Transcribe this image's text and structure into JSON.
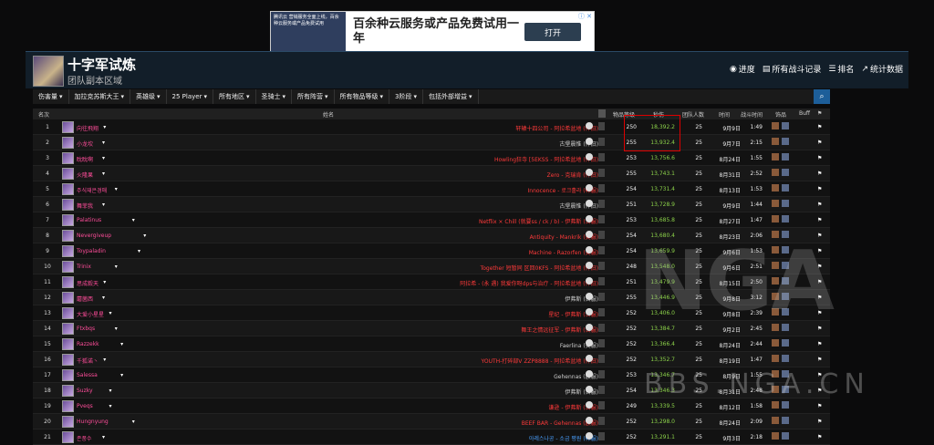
{
  "ad": {
    "left_text": "腾讯云 营销服务全面上线，百余种云服务或产品免费试用",
    "headline": "百余种云服务或产品免费试用一年",
    "button": "打开",
    "close": "ⓘ ✕"
  },
  "header": {
    "title": "十字军试炼",
    "subtitle": "团队副本区域",
    "nav": [
      {
        "icon": "globe-icon",
        "label": "进度"
      },
      {
        "icon": "list-icon",
        "label": "所有战斗记录"
      },
      {
        "icon": "ranking-icon",
        "label": "排名"
      },
      {
        "icon": "chart-icon",
        "label": "统计数据"
      }
    ]
  },
  "filters": [
    "伤害量",
    "加拉克苏斯大王",
    "英雄级",
    "25 Player",
    "所有地区",
    "圣骑士",
    "所有阵营",
    "所有物品等级",
    "3阶段",
    "包括外部增益"
  ],
  "columns": {
    "rank": "名次",
    "name": "姓名",
    "ilvl": "物品等级",
    "dps": "秒伤",
    "group": "团队人数",
    "date": "时间",
    "duration": "战斗时间",
    "gear": "饰品",
    "buff": "Buff"
  },
  "rows": [
    {
      "rank": "1",
      "name": "向往飛翔",
      "guild": "轩辕十四公司 - 阿拉希盆地 (怀旧)",
      "guild_color": "#ff3a3a",
      "ilvl": "250",
      "dps": "18,392.2",
      "group": "25",
      "date": "9月9日",
      "time": "1:49"
    },
    {
      "rank": "2",
      "name": "小龙坎",
      "guild": "古堡晨惟 (怀旧)",
      "guild_color": "#cfcfcf",
      "ilvl": "255",
      "dps": "13,932.4",
      "group": "25",
      "date": "9月7日",
      "time": "2:15"
    },
    {
      "rank": "3",
      "name": "眈眈啊",
      "guild": "Howling狂寺 [5EKSS - 阿拉希盆地 (怀旧)",
      "guild_color": "#ff3a3a",
      "ilvl": "253",
      "dps": "13,756.6",
      "group": "25",
      "date": "8月24日",
      "time": "1:55"
    },
    {
      "rank": "4",
      "name": "火隆果",
      "guild": "Zero - 克瑞肯 (怀旧)",
      "guild_color": "#ff3a3a",
      "ilvl": "255",
      "dps": "13,743.1",
      "group": "25",
      "date": "8月31日",
      "time": "2:52"
    },
    {
      "rank": "5",
      "name": "주식재은경매",
      "guild": "Innocence - 로크홀라 (韩服)",
      "guild_color": "#ff3a3a",
      "ilvl": "254",
      "dps": "13,731.4",
      "group": "25",
      "date": "8月13日",
      "time": "1:53"
    },
    {
      "rank": "6",
      "name": "舞菲我",
      "guild": "古堡晨惟 (怀旧)",
      "guild_color": "#cfcfcf",
      "ilvl": "251",
      "dps": "13,728.9",
      "group": "25",
      "date": "9月9日",
      "time": "1:44"
    },
    {
      "rank": "7",
      "name": "Palatinus",
      "guild": "Netflix × Chill (就要ss / ck / b) - 伊弗斯 (台服)",
      "guild_color": "#ff3a3a",
      "ilvl": "253",
      "dps": "13,685.8",
      "group": "25",
      "date": "8月27日",
      "time": "1:47"
    },
    {
      "rank": "8",
      "name": "Nevergiveup",
      "guild": "Antiquity - Mankrik (美服)",
      "guild_color": "#ff3a3a",
      "ilvl": "254",
      "dps": "13,680.4",
      "group": "25",
      "date": "8月23日",
      "time": "2:06"
    },
    {
      "rank": "9",
      "name": "Toypaladin",
      "guild": "Machine - Razorfen (美服)",
      "guild_color": "#ff3a3a",
      "ilvl": "254",
      "dps": "13,659.9",
      "group": "25",
      "date": "9月6日",
      "time": "1:53"
    },
    {
      "rank": "10",
      "name": "Trinix",
      "guild": "Together 短暂同 区回0KFS - 阿拉希盆地 (怀旧)",
      "guild_color": "#ff3a3a",
      "ilvl": "248",
      "dps": "13,548.0",
      "group": "25",
      "date": "9月6日",
      "time": "2:51"
    },
    {
      "rank": "11",
      "name": "思成毅天",
      "guild": "阿拉希 - (永 遇) 我爱你呀dps与治疗 - 阿拉希盆地 (怀旧)",
      "guild_color": "#ff3a3a",
      "ilvl": "251",
      "dps": "13,479.9",
      "group": "25",
      "date": "8月15日",
      "time": "2:50"
    },
    {
      "rank": "12",
      "name": "蘑菌西",
      "guild": "伊弗斯 (台服)",
      "guild_color": "#cfcfcf",
      "ilvl": "255",
      "dps": "13,446.9",
      "group": "25",
      "date": "9月8日",
      "time": "3:12"
    },
    {
      "rank": "13",
      "name": "大爱小星星",
      "guild": "星纪 - 伊弗斯 (台服)",
      "guild_color": "#ff3a3a",
      "ilvl": "252",
      "dps": "13,406.0",
      "group": "25",
      "date": "9月8日",
      "time": "2:39"
    },
    {
      "rank": "14",
      "name": "Ftxbqs",
      "guild": "舞王之情远征军 - 伊弗斯 (台服)",
      "guild_color": "#ff3a3a",
      "ilvl": "252",
      "dps": "13,384.7",
      "group": "25",
      "date": "9月2日",
      "time": "2:45"
    },
    {
      "rank": "15",
      "name": "Razzekk",
      "guild": "Faerlina (美服)",
      "guild_color": "#cfcfcf",
      "ilvl": "252",
      "dps": "13,366.4",
      "group": "25",
      "date": "8月24日",
      "time": "2:44"
    },
    {
      "rank": "16",
      "name": "千狐诺丶",
      "guild": "YOUTH-打碎部V ZZP8888 - 阿拉希盆地 (怀旧)",
      "guild_color": "#ff3a3a",
      "ilvl": "252",
      "dps": "13,352.7",
      "group": "25",
      "date": "8月19日",
      "time": "1:47"
    },
    {
      "rank": "17",
      "name": "Salessa",
      "guild": "Gehennas (欧服)",
      "guild_color": "#cfcfcf",
      "ilvl": "253",
      "dps": "13,346.7",
      "group": "25",
      "date": "8月9日",
      "time": "1:55"
    },
    {
      "rank": "18",
      "name": "Suzky",
      "guild": "伊弗斯 (台服)",
      "guild_color": "#cfcfcf",
      "ilvl": "254",
      "dps": "13,346.3",
      "group": "25",
      "date": "8月31日",
      "time": "2:48"
    },
    {
      "rank": "19",
      "name": "Pveqs",
      "guild": "谦逊 - 伊弗斯 (台服)",
      "guild_color": "#ff3a3a",
      "ilvl": "249",
      "dps": "13,339.5",
      "group": "25",
      "date": "8月12日",
      "time": "1:58"
    },
    {
      "rank": "20",
      "name": "Hungnyung",
      "guild": "BEEF BAR - Gehennas (欧服)",
      "guild_color": "#ff3a3a",
      "ilvl": "252",
      "dps": "13,298.0",
      "group": "25",
      "date": "8月24日",
      "time": "2:09"
    },
    {
      "rank": "21",
      "name": "존풍수",
      "guild": "아레스나공 - 소금 평원 (韩服)",
      "guild_color": "#4aa0ff",
      "ilvl": "252",
      "dps": "13,291.1",
      "group": "25",
      "date": "9月3日",
      "time": "2:18"
    }
  ],
  "watermark": {
    "big": "NGA",
    "small": "BBS.NGA.CN"
  }
}
